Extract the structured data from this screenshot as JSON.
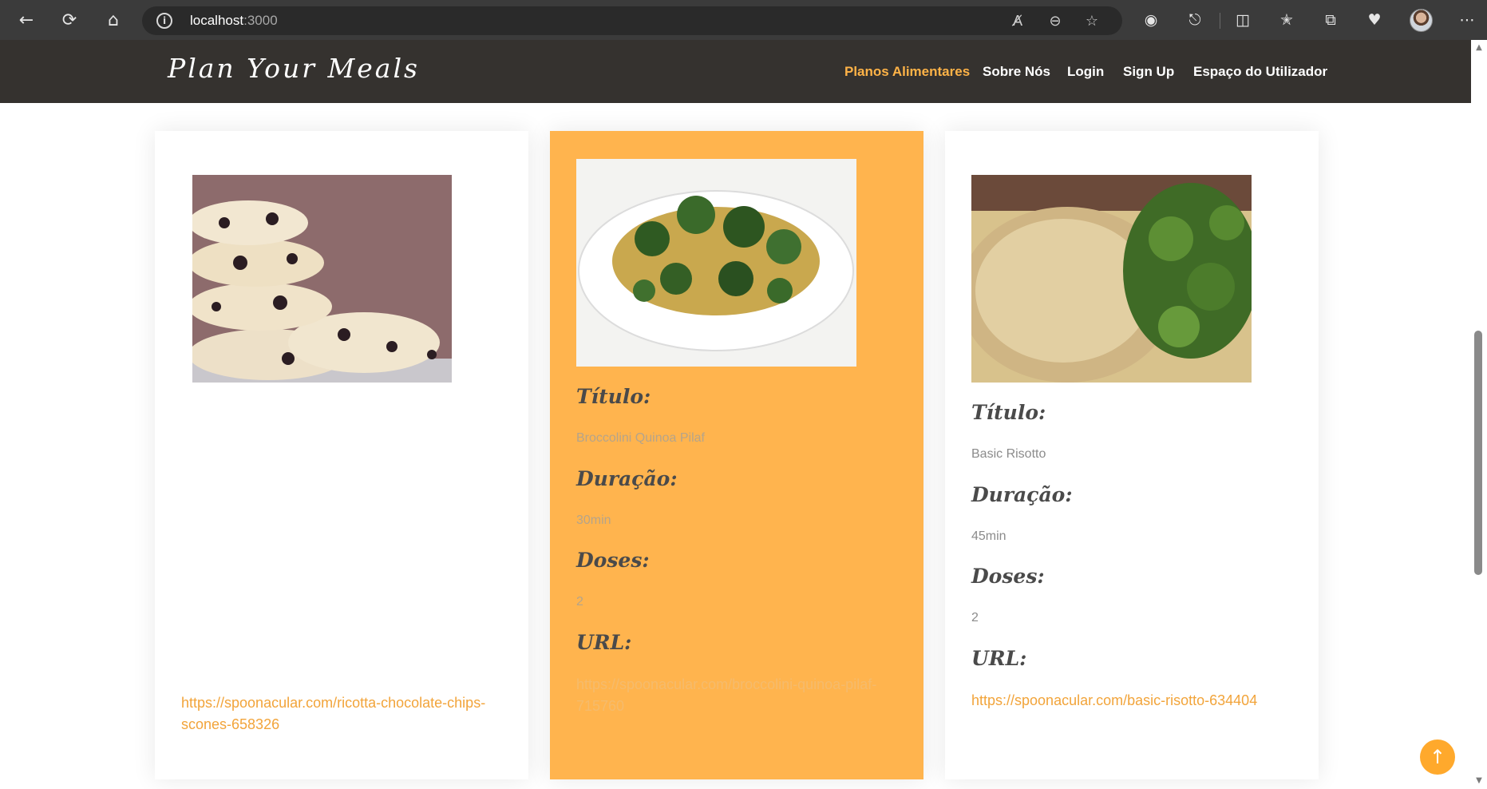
{
  "browser": {
    "url_host": "localhost",
    "url_port": ":3000"
  },
  "site": {
    "logo": "Plan Your Meals",
    "nav": {
      "items": [
        {
          "label": "Planos Alimentares"
        },
        {
          "label": "Sobre Nós"
        },
        {
          "label": "Login"
        },
        {
          "label": "Sign Up"
        },
        {
          "label": "Espaço do Utilizador"
        }
      ],
      "active_color": "#ffb347"
    }
  },
  "labels": {
    "title": "Título:",
    "duration": "Duração:",
    "doses": "Doses:",
    "url": "URL:"
  },
  "cards": [
    {
      "image": "ricotta-chocolate-chip-scones-photo",
      "url_line1": "https://spoonacular.com/ricotta-chocolate-chips-",
      "url_line2": "scones-658326"
    },
    {
      "image": "broccolini-quinoa-pilaf-photo",
      "title": "Broccolini Quinoa Pilaf",
      "duration": "30min",
      "doses": "2",
      "url_line1": "https://spoonacular.com/broccolini-quinoa-pilaf-",
      "url_line2": "715760",
      "background": "#ffb44e"
    },
    {
      "image": "basic-risotto-photo",
      "title": "Basic Risotto",
      "duration": "45min",
      "doses": "2",
      "url_line1": "https://spoonacular.com/basic-risotto-634404"
    }
  ],
  "colors": {
    "nav_bg": "#35322f",
    "accent": "#f2a43a"
  }
}
